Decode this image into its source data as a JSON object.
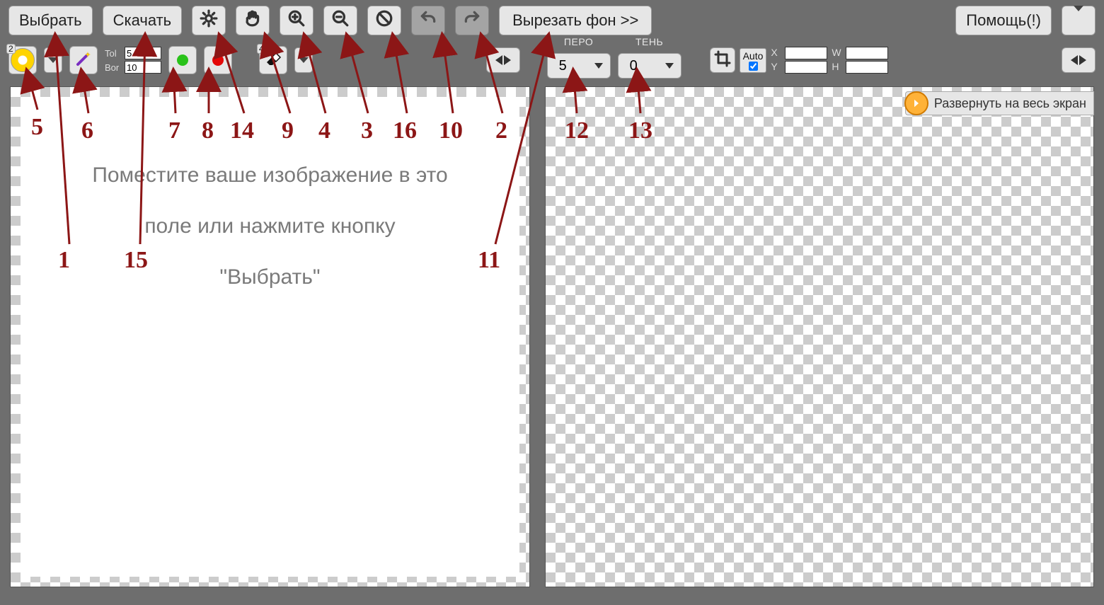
{
  "toolbar1": {
    "select": "Выбрать",
    "download": "Скачать",
    "cutbg": "Вырезать фон >>",
    "help": "Помощь(!)"
  },
  "toolbar2": {
    "tol_label": "Tol",
    "tol_value": "5",
    "bor_label": "Bor",
    "bor_value": "10",
    "badge_left": "2",
    "badge_eraser": "4",
    "pero_label": "ПЕРО",
    "pero_value": "5",
    "ten_label": "ТЕНЬ",
    "ten_value": "0",
    "auto_label": "Auto",
    "auto_checked": true,
    "x_label": "X",
    "y_label": "Y",
    "w_label": "W",
    "h_label": "H",
    "x_value": "",
    "y_value": "",
    "w_value": "",
    "h_value": ""
  },
  "canvas": {
    "placeholder_l1": "Поместите ваше изображение в это",
    "placeholder_l2": "поле или нажмите кнопку",
    "placeholder_l3": "\"Выбрать\""
  },
  "expand": "Развернуть на весь экран",
  "annotations": {
    "1": "1",
    "2": "2",
    "3": "3",
    "4": "4",
    "5": "5",
    "6": "6",
    "7": "7",
    "8": "8",
    "9": "9",
    "10": "10",
    "11": "11",
    "12": "12",
    "13": "13",
    "14": "14",
    "15": "15",
    "16": "16"
  }
}
